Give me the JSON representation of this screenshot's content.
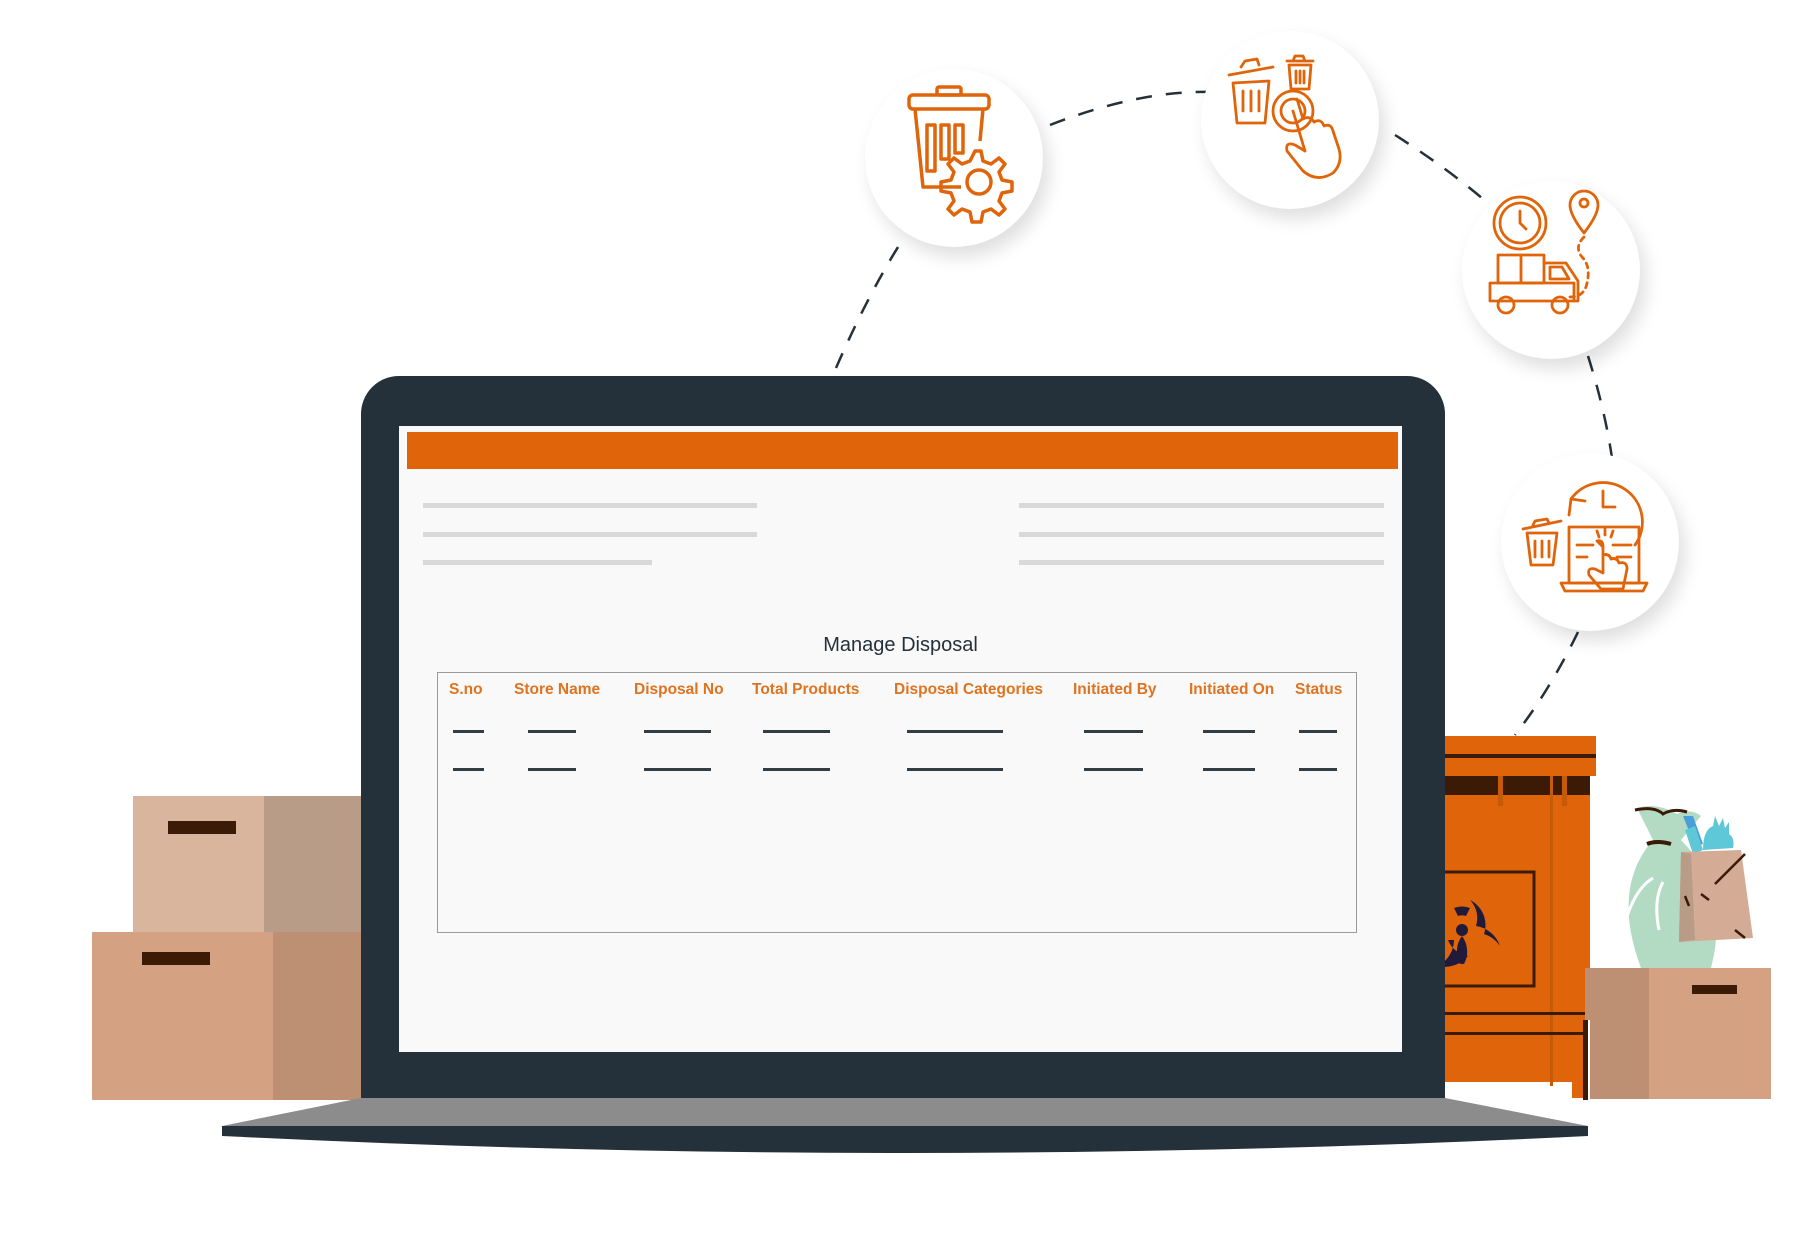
{
  "app": {
    "page_title": "Manage Disposal",
    "accent_color": "#e0650a",
    "header_text_color": "#e0731e"
  },
  "table": {
    "columns": [
      "S.no",
      "Store Name",
      "Disposal No",
      "Total Products",
      "Disposal Categories",
      "Initiated By",
      "Initiated On",
      "Status"
    ],
    "rows": [
      [
        "—",
        "—",
        "—",
        "—",
        "—",
        "—",
        "—",
        "—"
      ],
      [
        "—",
        "—",
        "—",
        "—",
        "—",
        "—",
        "—",
        "—"
      ]
    ]
  },
  "workflow_icons": [
    {
      "name": "trash-settings-icon",
      "label": "Disposal configuration"
    },
    {
      "name": "select-trash-icon",
      "label": "Select disposal"
    },
    {
      "name": "scheduled-delivery-icon",
      "label": "Pickup & transport"
    },
    {
      "name": "scheduled-disposal-icon",
      "label": "Scheduled disposal"
    }
  ]
}
